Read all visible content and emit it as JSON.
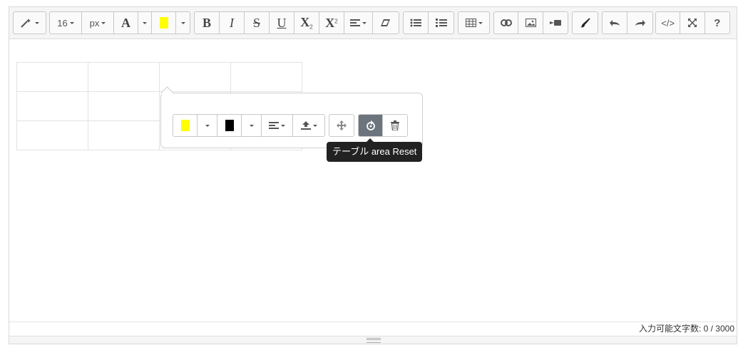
{
  "toolbar": {
    "font_size": "16",
    "font_unit": "px",
    "font_color_letter": "A",
    "highlight_color": "#ffff00",
    "bold": "B",
    "italic": "I",
    "strikethrough": "S",
    "underline": "U",
    "subscript": "X",
    "subscript_mark": "2",
    "superscript": "X",
    "superscript_mark": "2",
    "code_view": "</>",
    "help": "?"
  },
  "table": {
    "rows": 3,
    "cols": 4
  },
  "table_popover": {
    "cell_background_color": "#ffff00",
    "text_color": "#000000",
    "reset_tooltip": "テーブル area Reset"
  },
  "status": {
    "char_count": "入力可能文字数: 0 / 3000"
  }
}
